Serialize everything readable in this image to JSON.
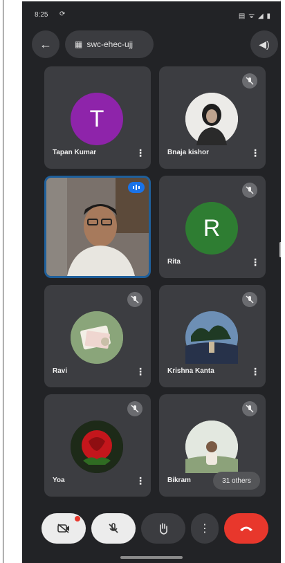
{
  "status_bar": {
    "time": "8:25",
    "left_icon": "⟳",
    "right_icons": "▤ ᯤ ◢ ▮"
  },
  "top_bar": {
    "back_icon": "←",
    "meeting_code": "swc-ehec-ujj",
    "calendar_icon": "▦",
    "audio_icon": "◀)"
  },
  "participants": [
    {
      "name": "Tapan Kumar",
      "initial": "T",
      "avatar_color": "#8e24aa"
    },
    {
      "name": "Bnaja kishor"
    },
    {
      "name": ""
    },
    {
      "name": "Rita",
      "initial": "R",
      "avatar_color": "#2e7d32"
    },
    {
      "name": "Ravi"
    },
    {
      "name": "Krishna Kanta"
    },
    {
      "name": "Yoa"
    },
    {
      "name": "Bikram"
    }
  ],
  "others_chip": "31 others",
  "colors": {
    "background": "#222326",
    "tile": "#3c3d41",
    "end_call": "#e8372c",
    "speaking": "#1a73e8"
  },
  "controls": {
    "camera_icon": "▭",
    "mic_icon": "🎙",
    "hand_icon": "✋",
    "more_icon": "⋮",
    "end_icon": "☎"
  }
}
